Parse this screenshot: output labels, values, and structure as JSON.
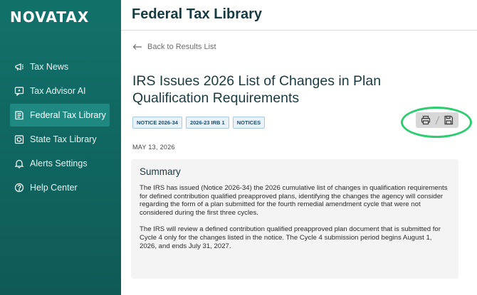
{
  "app": {
    "logo": "NOVATAX"
  },
  "sidebar": {
    "items": [
      {
        "label": "Tax News",
        "icon": "megaphone-icon"
      },
      {
        "label": "Tax Advisor AI",
        "icon": "ai-chat-icon"
      },
      {
        "label": "Federal Tax Library",
        "icon": "book-icon",
        "active": true
      },
      {
        "label": "State Tax Library",
        "icon": "state-library-icon"
      },
      {
        "label": "Alerts Settings",
        "icon": "bell-icon"
      },
      {
        "label": "Help Center",
        "icon": "help-icon"
      }
    ]
  },
  "header": {
    "title": "Federal Tax Library"
  },
  "main": {
    "back_label": "Back to Results List",
    "title": "IRS Issues 2026 List of Changes in Plan Qualification Requirements",
    "tags": [
      "NOTICE 2026-34",
      "2026-23 IRB 1",
      "NOTICES"
    ],
    "date": "MAY 13, 2026",
    "summary": {
      "heading": "Summary",
      "paragraphs": [
        "The IRS has issued (Notice 2026-34) the 2026 cumulative list of changes in qualification requirements for defined contribution qualified preapproved plans, identifying the changes the agency will consider regarding the form of a plan submitted for the fourth remedial amendment cycle that were not considered during the first three cycles.",
        "The IRS will review a defined contribution qualified preapproved plan document that is submitted for Cycle 4 only for the changes listed in the notice. The Cycle 4 submission period begins August 1, 2026, and ends July 31, 2027."
      ]
    },
    "toolbar": {
      "icons": [
        "print-icon",
        "save-icon"
      ]
    }
  },
  "colors": {
    "sidebar": "#12716b",
    "sidebar_active": "#1f8880",
    "highlight": "#2ecc71",
    "title_text": "#1b3a40"
  }
}
